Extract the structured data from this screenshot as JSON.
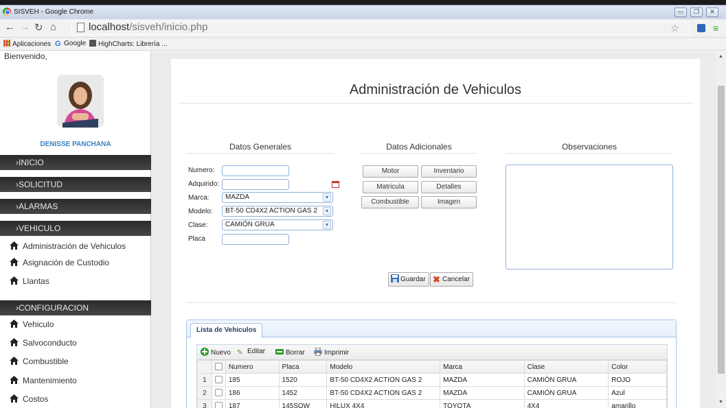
{
  "browser": {
    "window_title": "SISVEH - Google Chrome",
    "url_host": "localhost",
    "url_path": "/sisveh/inicio.php",
    "bookmarks": [
      "Aplicaciones",
      "Google",
      "HighCharts: Librería ..."
    ]
  },
  "sidebar": {
    "welcome": "Bienvenido,",
    "user_name": "DENISSE PANCHANA",
    "sections": {
      "inicio": "›INICIO",
      "solicitud": "›SOLICITUD",
      "alarmas": "›ALARMAS",
      "vehiculo": "›VEHICULO",
      "configuracion": "›CONFIGURACION"
    },
    "vehiculo_items": [
      "Administración de Vehiculos",
      "Asignación de Custodio",
      "Llantas"
    ],
    "config_items": [
      "Vehiculo",
      "Salvoconducto",
      "Combustible",
      "Mantenimiento",
      "Costos"
    ]
  },
  "main": {
    "title": "Administración de Vehiculos",
    "col_headers": {
      "generales": "Datos Generales",
      "adicionales": "Datos Adicionales",
      "observaciones": "Observaciones"
    },
    "form": {
      "numero_label": "Numero:",
      "adquirido_label": "Adquirido:",
      "marca_label": "Marca:",
      "marca_value": "MAZDA",
      "modelo_label": "Modelo:",
      "modelo_value": "BT-50 CD4X2 ACTION GAS 2",
      "clase_label": "Clase:",
      "clase_value": "CAMIÓN GRUA",
      "placa_label": "Placa"
    },
    "extra_buttons": {
      "motor": "Motor",
      "inventario": "Inventario",
      "matricula": "Matricula",
      "detalles": "Detalles",
      "combustible": "Combustible",
      "imagen": "Imagen"
    },
    "guardar": "Guardar",
    "cancelar": "Cancelar"
  },
  "list": {
    "tab": "Lista de Vehiculos",
    "toolbar": {
      "nuevo": "Nuevo",
      "editar": "Editar",
      "borrar": "Borrar",
      "imprimir": "Imprimir"
    },
    "columns": [
      "Numero",
      "Placa",
      "Modelo",
      "Marca",
      "Clase",
      "Color"
    ],
    "rows": [
      [
        "1",
        "185",
        "1520",
        "BT-50 CD4X2 ACTION GAS 2",
        "MAZDA",
        "CAMIÓN GRUA",
        "ROJO"
      ],
      [
        "2",
        "186",
        "1452",
        "BT-50 CD4X2 ACTION GAS 2",
        "MAZDA",
        "CAMIÓN GRUA",
        "Azul"
      ],
      [
        "3",
        "187",
        "145SOW",
        "HILUX 4X4",
        "TOYOTA",
        "4X4",
        "amarillo"
      ]
    ]
  },
  "colors": {
    "accent_blue": "#3a7fc1",
    "sidebar_section": "#333333",
    "input_border": "#8fb0d9"
  }
}
